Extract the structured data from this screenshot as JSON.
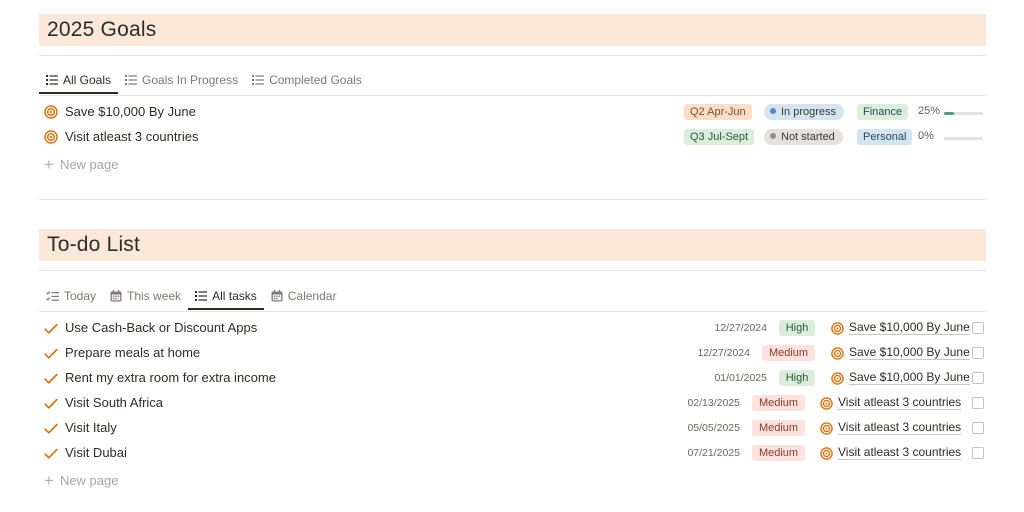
{
  "goals": {
    "title": "2025 Goals",
    "tabs": [
      {
        "label": "All Goals",
        "active": true,
        "icon": "list-icon"
      },
      {
        "label": "Goals In Progress",
        "active": false,
        "icon": "list-icon"
      },
      {
        "label": "Completed Goals",
        "active": false,
        "icon": "list-icon"
      }
    ],
    "rows": [
      {
        "title": "Save $10,000 By June",
        "quarter": "Q2 Apr-Jun",
        "status": "In progress",
        "category": "Finance",
        "progress_label": "25%",
        "progress": 0.25
      },
      {
        "title": "Visit atleast 3 countries",
        "quarter": "Q3 Jul-Sept",
        "status": "Not started",
        "category": "Personal",
        "progress_label": "0%",
        "progress": 0
      }
    ],
    "new_page": "New page"
  },
  "todo": {
    "title": "To-do List",
    "tabs": [
      {
        "label": "Today",
        "active": false,
        "icon": "checklist-icon"
      },
      {
        "label": "This week",
        "active": false,
        "icon": "calendar-icon"
      },
      {
        "label": "All tasks",
        "active": true,
        "icon": "list-icon"
      },
      {
        "label": "Calendar",
        "active": false,
        "icon": "calendar-icon"
      }
    ],
    "rows": [
      {
        "title": "Use Cash-Back or Discount Apps",
        "date": "12/27/2024",
        "priority": "High",
        "goal": "Save $10,000 By June",
        "checked": false
      },
      {
        "title": "Prepare meals at home",
        "date": "12/27/2024",
        "priority": "Medium",
        "goal": "Save $10,000 By June",
        "checked": false
      },
      {
        "title": "Rent my extra room for extra income",
        "date": "01/01/2025",
        "priority": "High",
        "goal": "Save $10,000 By June",
        "checked": false
      },
      {
        "title": "Visit South Africa",
        "date": "02/13/2025",
        "priority": "Medium",
        "goal": "Visit atleast 3 countries",
        "checked": false
      },
      {
        "title": "Visit Italy",
        "date": "05/05/2025",
        "priority": "Medium",
        "goal": "Visit atleast 3 countries",
        "checked": false
      },
      {
        "title": "Visit Dubai",
        "date": "07/21/2025",
        "priority": "Medium",
        "goal": "Visit atleast 3 countries",
        "checked": false
      }
    ],
    "new_page": "New page"
  },
  "colors": {
    "banner": "#fbe8d8",
    "accent": "#d9730d",
    "quarter_q2_bg": "#fadec9",
    "quarter_q2_fg": "#8a4a1c",
    "quarter_q3_bg": "#dbeddb",
    "quarter_q3_fg": "#2b593f",
    "status_in_progress_bg": "#d3e5ef",
    "status_in_progress_dot": "#5e87c9",
    "status_not_started_bg": "#e3e2e0",
    "status_not_started_dot": "#91918e",
    "finance_bg": "#dbeddb",
    "personal_bg": "#d3e5ef",
    "high_bg": "#dbeddb",
    "high_fg": "#2b593f",
    "medium_bg": "#ffe2dd",
    "medium_fg": "#8a3a2a",
    "progress_fill": "#4e9c7b"
  }
}
